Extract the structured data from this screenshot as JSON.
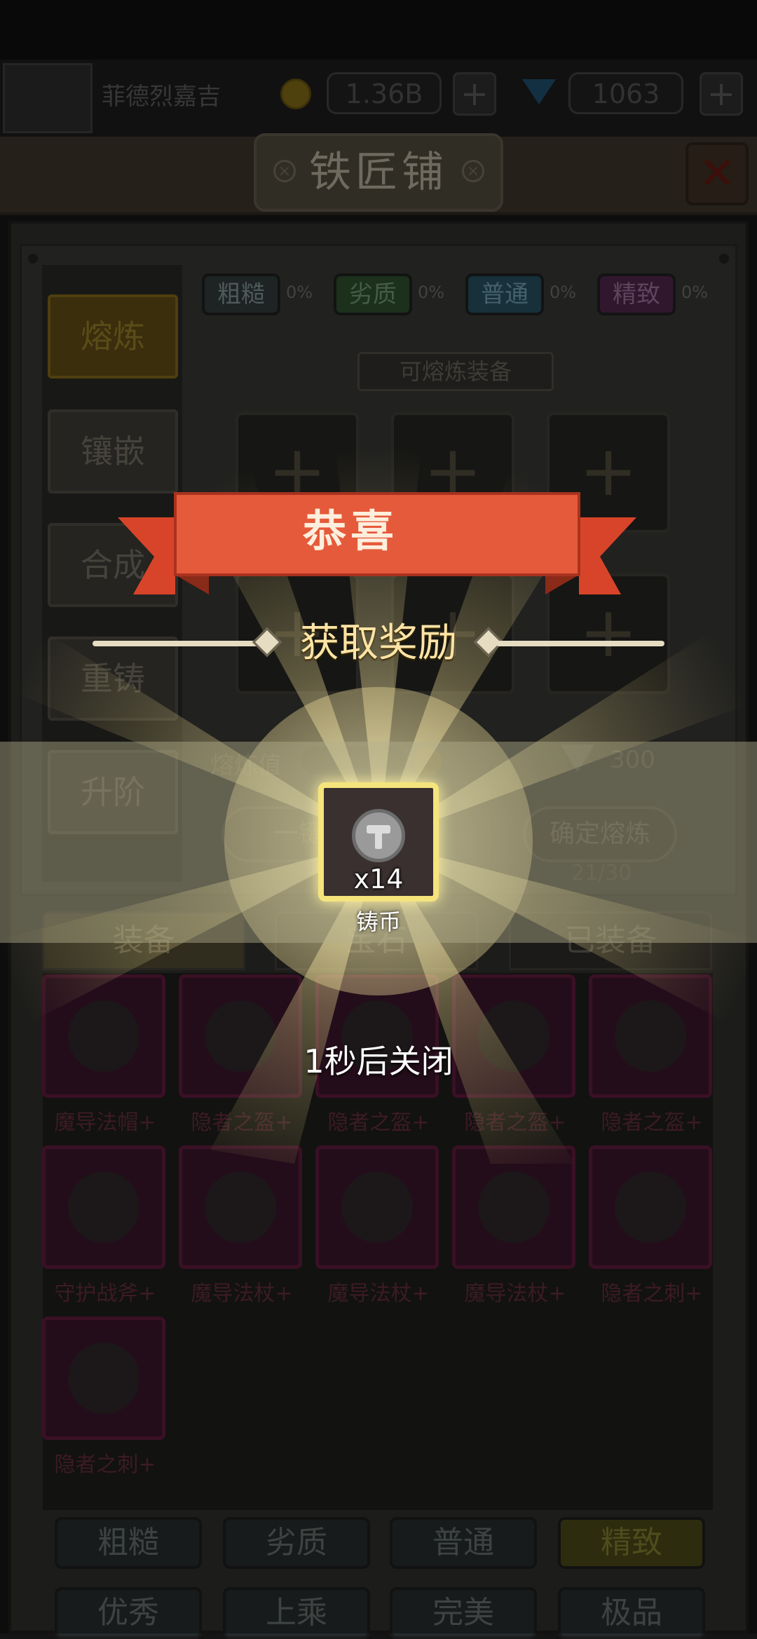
{
  "topbar": {
    "player_name": "菲德烈嘉吉",
    "gold": "1.36B",
    "gems": "1063",
    "add_symbol": "+"
  },
  "window": {
    "title": "铁匠铺",
    "close_symbol": "✕"
  },
  "side_tabs": [
    "熔炼",
    "镶嵌",
    "合成",
    "重铸",
    "升阶"
  ],
  "quality_filters": [
    {
      "label": "粗糙",
      "pct": "0%",
      "color": "#5a6a6c"
    },
    {
      "label": "劣质",
      "pct": "0%",
      "color": "#3c6e3a"
    },
    {
      "label": "普通",
      "pct": "0%",
      "color": "#2f6f86"
    },
    {
      "label": "精致",
      "pct": "0%",
      "color": "#6a2c6e"
    }
  ],
  "smelt": {
    "header": "可熔炼装备",
    "slot_symbol": "+",
    "value_label": "熔炼值",
    "cost": "300",
    "one_key_button": "一键",
    "confirm_button": "确定熔炼",
    "count": "21/30"
  },
  "bottom_tabs": [
    "装备",
    "宝石",
    "已装备"
  ],
  "items": [
    {
      "name": "魔导法帽+"
    },
    {
      "name": "隐者之盔+"
    },
    {
      "name": "隐者之盔+"
    },
    {
      "name": "隐者之盔+"
    },
    {
      "name": "隐者之盔+"
    },
    {
      "name": "守护战斧+"
    },
    {
      "name": "魔导法杖+"
    },
    {
      "name": "魔导法杖+"
    },
    {
      "name": "魔导法杖+"
    },
    {
      "name": "隐者之刺+"
    },
    {
      "name": "隐者之刺+"
    }
  ],
  "quality_buttons": [
    "粗糙",
    "劣质",
    "普通",
    "精致",
    "优秀",
    "上乘",
    "完美",
    "极品"
  ],
  "popup": {
    "banner": "恭喜",
    "title": "获取奖励",
    "reward_name": "铸币",
    "reward_qty": "x14",
    "countdown": "1秒后关闭"
  }
}
